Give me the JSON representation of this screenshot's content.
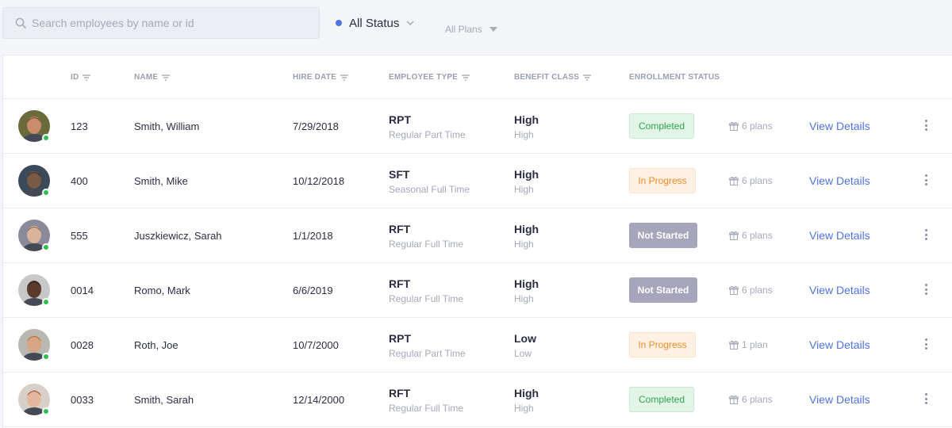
{
  "search": {
    "placeholder": "Search employees by name or id",
    "value": ""
  },
  "filters": {
    "status": "All Status",
    "plans": "All Plans"
  },
  "colors": {
    "accent": "#4f73e3",
    "online": "#2ec04f",
    "completed": "#2ea44f",
    "in_progress": "#f08a24",
    "not_started": "#a6a5bc"
  },
  "columns": {
    "id": "ID",
    "name": "NAME",
    "hire_date": "HIRE DATE",
    "employee_type": "EMPLOYEE TYPE",
    "benefit_class": "BENEFIT CLASS",
    "enrollment_status": "ENROLLMENT STATUS"
  },
  "rows": [
    {
      "id": "123",
      "name": "Smith, William",
      "hire_date": "7/29/2018",
      "type_code": "RPT",
      "type_desc": "Regular Part Time",
      "class_main": "High",
      "class_sub": "High",
      "status": "Completed",
      "status_kind": "completed",
      "plans": "6 plans",
      "action": "View Details",
      "online": true
    },
    {
      "id": "400",
      "name": "Smith, Mike",
      "hire_date": "10/12/2018",
      "type_code": "SFT",
      "type_desc": "Seasonal Full Time",
      "class_main": "High",
      "class_sub": "High",
      "status": "In Progress",
      "status_kind": "progress",
      "plans": "6 plans",
      "action": "View Details",
      "online": true
    },
    {
      "id": "555",
      "name": "Juszkiewicz, Sarah",
      "hire_date": "1/1/2018",
      "type_code": "RFT",
      "type_desc": "Regular Full Time",
      "class_main": "High",
      "class_sub": "High",
      "status": "Not Started",
      "status_kind": "notstarted",
      "plans": "6 plans",
      "action": "View Details",
      "online": true
    },
    {
      "id": "0014",
      "name": "Romo, Mark",
      "hire_date": "6/6/2019",
      "type_code": "RFT",
      "type_desc": "Regular Full Time",
      "class_main": "High",
      "class_sub": "High",
      "status": "Not Started",
      "status_kind": "notstarted",
      "plans": "6 plans",
      "action": "View Details",
      "online": true
    },
    {
      "id": "0028",
      "name": "Roth, Joe",
      "hire_date": "10/7/2000",
      "type_code": "RPT",
      "type_desc": "Regular Part Time",
      "class_main": "Low",
      "class_sub": "Low",
      "status": "In Progress",
      "status_kind": "progress",
      "plans": "1 plan",
      "action": "View Details",
      "online": true
    },
    {
      "id": "0033",
      "name": "Smith, Sarah",
      "hire_date": "12/14/2000",
      "type_code": "RFT",
      "type_desc": "Regular Full Time",
      "class_main": "High",
      "class_sub": "High",
      "status": "Completed",
      "status_kind": "completed",
      "plans": "6 plans",
      "action": "View Details",
      "online": true
    }
  ]
}
